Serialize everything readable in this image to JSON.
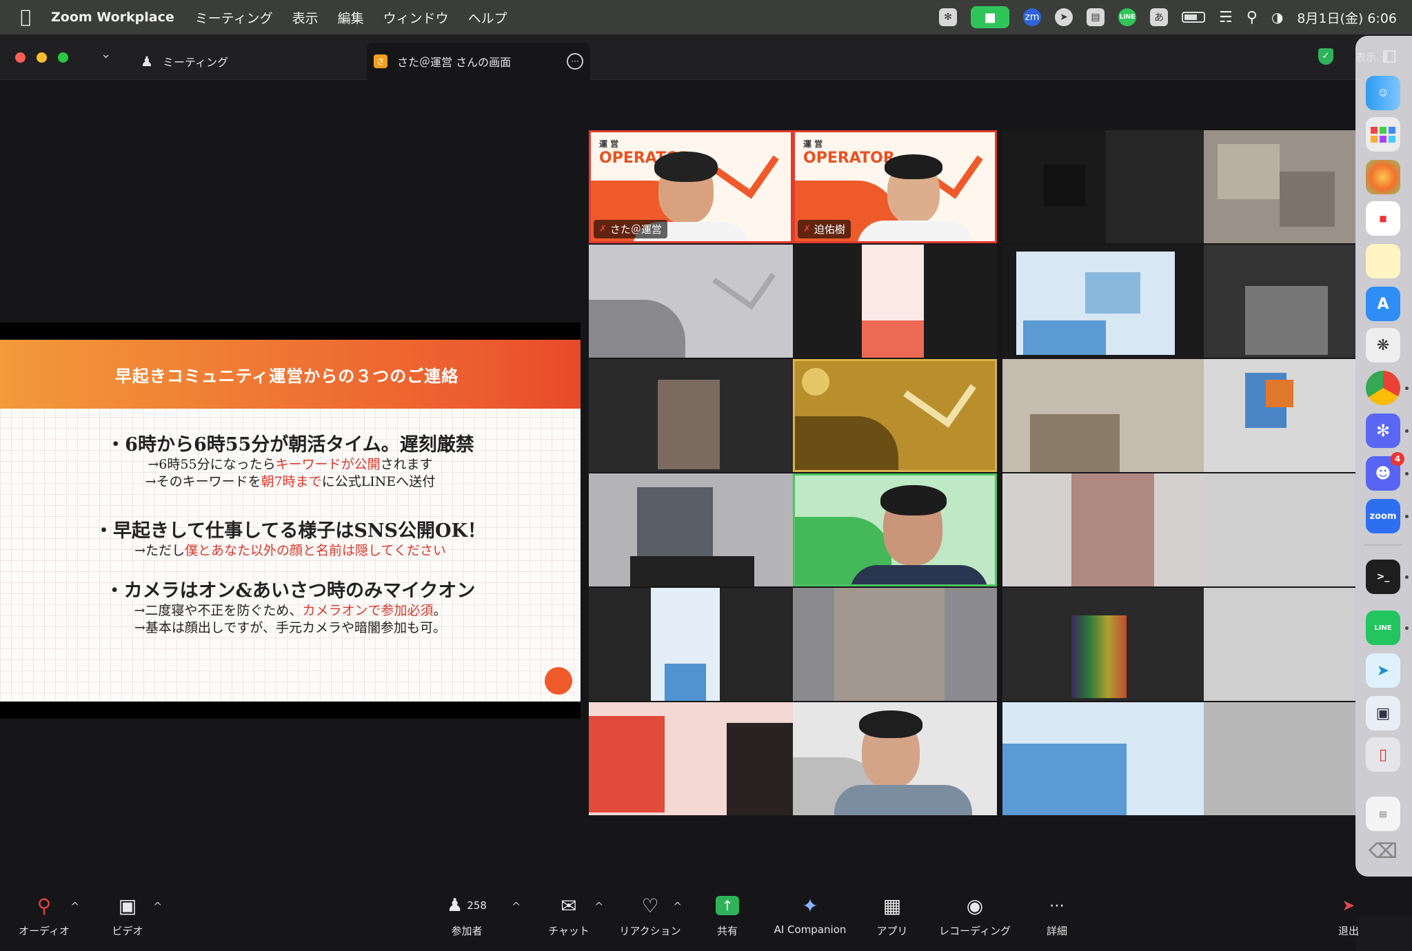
{
  "menubar": {
    "app_name": "Zoom Workplace",
    "items": [
      "ミーティング",
      "表示",
      "編集",
      "ウィンドウ",
      "ヘルプ"
    ],
    "zm_label": "zm",
    "line_label": "LINE",
    "ime": "あ",
    "datetime": "8月1日(金) 6:06"
  },
  "window": {
    "meeting_tab": "ミーティング",
    "share_tab": "さた＠運営 さんの画面",
    "share_badge": "さ",
    "view_label": "表示"
  },
  "slide": {
    "title": "早起きコミュニティ運営からの３つのご連絡",
    "sections": [
      {
        "heading": "・6時から6時55分が朝活タイム。遅刻厳禁",
        "lines": [
          {
            "pre": "→6時55分になったら",
            "red": "キーワードが公開",
            "post": "されます"
          },
          {
            "pre": "→そのキーワードを",
            "red": "朝7時まで",
            "post": "に公式LINEへ送付"
          }
        ]
      },
      {
        "heading": "・早起きして仕事してる様子はSNS公開OK！",
        "lines": [
          {
            "pre": "→ただし",
            "red": "僕とあなた以外の顔と名前は隠してください",
            "post": ""
          }
        ]
      },
      {
        "heading": "・カメラはオン&あいさつ時のみマイクオン",
        "lines": [
          {
            "pre": "→二度寝や不正を防ぐため、",
            "red": "カメラオンで参加必須",
            "post": "。"
          },
          {
            "pre": "→基本は顔出しですが、手元カメラや暗闇参加も可。",
            "red": "",
            "post": ""
          }
        ]
      }
    ]
  },
  "videos": {
    "operator_jp": "運 営",
    "operator_en": "OPERATOR",
    "participants": [
      {
        "name": "さた＠運営"
      },
      {
        "name": "迫佑樹"
      }
    ]
  },
  "dock": {
    "zoom_label": "zoom",
    "line_label": "LINE",
    "discord_badge": "4",
    "terminal_label": ">_"
  },
  "toolbar": {
    "audio": "オーディオ",
    "video": "ビデオ",
    "participants_count": "258",
    "participants": "参加者",
    "chat": "チャット",
    "reactions": "リアクション",
    "share": "共有",
    "ai_companion": "AI Companion",
    "apps": "アプリ",
    "recording": "レコーディング",
    "more": "詳細",
    "leave": "退出"
  },
  "colors": {
    "share_green": "#2fb35a",
    "slide_orange": "#ec5a2e",
    "slide_red_text": "#d8392b",
    "leave_red": "#e5484d"
  }
}
